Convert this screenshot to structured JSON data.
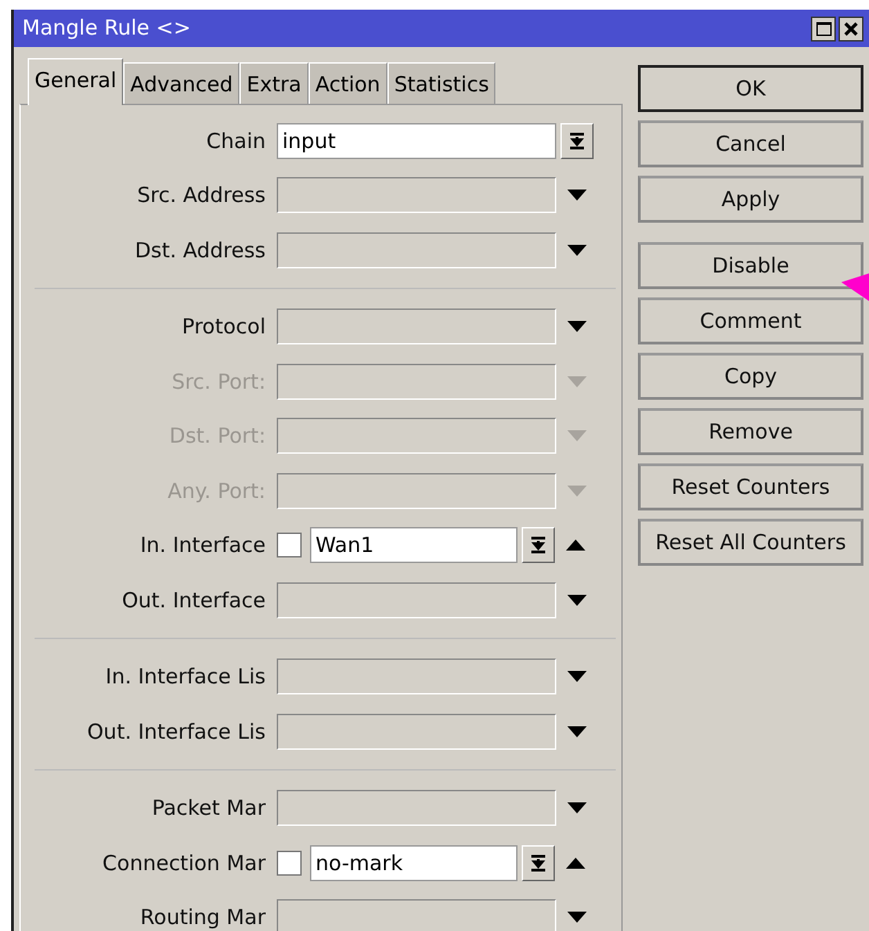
{
  "window": {
    "title": "Mangle Rule <>"
  },
  "tabs": [
    {
      "label": "General",
      "selected": true
    },
    {
      "label": "Advanced",
      "selected": false
    },
    {
      "label": "Extra",
      "selected": false
    },
    {
      "label": "Action",
      "selected": false
    },
    {
      "label": "Statistics",
      "selected": false
    }
  ],
  "sections": [
    {
      "rows": [
        {
          "kind": "combo",
          "label": "Chain",
          "value": "input"
        },
        {
          "kind": "dropdown",
          "label": "Src. Address",
          "disabled": false
        },
        {
          "kind": "dropdown",
          "label": "Dst. Address",
          "disabled": false
        }
      ]
    },
    {
      "rows": [
        {
          "kind": "dropdown",
          "label": "Protocol",
          "disabled": false
        },
        {
          "kind": "dropdown",
          "label": "Src. Port:",
          "disabled": true
        },
        {
          "kind": "dropdown",
          "label": "Dst. Port:",
          "disabled": true
        },
        {
          "kind": "dropdown",
          "label": "Any. Port:",
          "disabled": true
        },
        {
          "kind": "negatable",
          "label": "In. Interface",
          "checked": false,
          "value": "Wan1"
        },
        {
          "kind": "dropdown",
          "label": "Out. Interface",
          "disabled": false
        }
      ]
    },
    {
      "rows": [
        {
          "kind": "dropdown",
          "label": "In. Interface Lis",
          "disabled": false
        },
        {
          "kind": "dropdown",
          "label": "Out. Interface Lis",
          "disabled": false
        }
      ]
    },
    {
      "rows": [
        {
          "kind": "dropdown",
          "label": "Packet Mar",
          "disabled": false
        },
        {
          "kind": "negatable",
          "label": "Connection Mar",
          "checked": false,
          "value": "no-mark"
        },
        {
          "kind": "dropdown",
          "label": "Routing Mar",
          "disabled": false
        }
      ]
    }
  ],
  "button_groups": [
    {
      "buttons": [
        {
          "label": "OK",
          "default": true
        },
        {
          "label": "Cancel",
          "default": false
        },
        {
          "label": "Apply",
          "default": false
        }
      ]
    },
    {
      "buttons": [
        {
          "label": "Disable",
          "default": false
        },
        {
          "label": "Comment",
          "default": false
        },
        {
          "label": "Copy",
          "default": false
        },
        {
          "label": "Remove",
          "default": false
        },
        {
          "label": "Reset Counters",
          "default": false
        },
        {
          "label": "Reset All Counters",
          "default": false
        }
      ]
    }
  ]
}
